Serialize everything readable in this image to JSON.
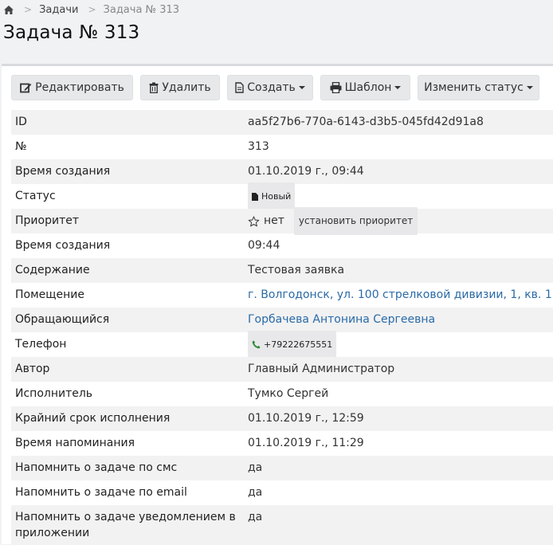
{
  "breadcrumb": {
    "items": [
      "Задачи",
      "Задача № 313"
    ]
  },
  "page": {
    "title": "Задача № 313"
  },
  "toolbar": {
    "edit": "Редактировать",
    "delete": "Удалить",
    "create": "Создать",
    "template": "Шаблон",
    "change_status": "Изменить статус"
  },
  "details": [
    {
      "label": "ID",
      "value": "aa5f27b6-770a-6143-d3b5-045fd42d91a8"
    },
    {
      "label": "№",
      "value": "313"
    },
    {
      "label": "Время создания",
      "value": "01.10.2019 г., 09:44"
    },
    {
      "label": "Статус",
      "value": "Новый"
    },
    {
      "label": "Приоритет",
      "value": "нет",
      "action": "установить приоритет"
    },
    {
      "label": "Время создания",
      "value": "09:44"
    },
    {
      "label": "Содержание",
      "value": "Тестовая заявка"
    },
    {
      "label": "Помещение",
      "value": "г. Волгодонск, ул. 100 стрелковой дивизии, 1, кв. 1"
    },
    {
      "label": "Обращающийся",
      "value": "Горбачева Антонина Сергеевна"
    },
    {
      "label": "Телефон",
      "value": "+79222675551"
    },
    {
      "label": "Автор",
      "value": "Главный Администратор"
    },
    {
      "label": "Исполнитель",
      "value": "Тумко Сергей"
    },
    {
      "label": "Крайний срок исполнения",
      "value": "01.10.2019 г., 12:59"
    },
    {
      "label": "Время напоминания",
      "value": "01.10.2019 г., 11:29"
    },
    {
      "label": "Напомнить о задаче по смс",
      "value": "да"
    },
    {
      "label": "Напомнить о задаче по email",
      "value": "да"
    },
    {
      "label": "Напомнить о задаче уведомлением в приложении",
      "value": "да"
    }
  ],
  "colors": {
    "link": "#2a6aa6",
    "phone_icon": "#2e8b3a",
    "row_alt": "#f2f2f3"
  }
}
